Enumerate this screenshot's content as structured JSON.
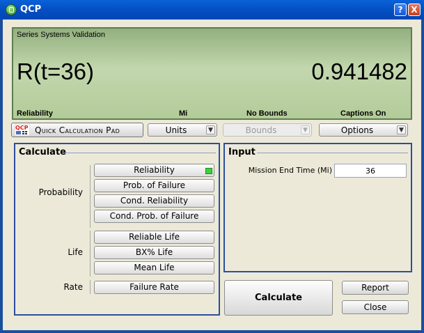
{
  "window": {
    "title": "QCP",
    "help_symbol": "?",
    "close_symbol": "X"
  },
  "display": {
    "title": "Series Systems Validation",
    "result_label": "R(t=36)",
    "result_value": "0.941482",
    "status": {
      "metric": "Reliability",
      "units": "Mi",
      "bounds": "No Bounds",
      "captions": "Captions On"
    }
  },
  "toolbar": {
    "qcp_button_label": "Quick Calculation Pad",
    "units_label": "Units",
    "bounds_label": "Bounds",
    "options_label": "Options"
  },
  "calculate": {
    "title": "Calculate",
    "groups": {
      "probability": "Probability",
      "life": "Life",
      "rate": "Rate"
    },
    "buttons": {
      "reliability": "Reliability",
      "prob_failure": "Prob. of Failure",
      "cond_reliability": "Cond. Reliability",
      "cond_prob_failure": "Cond. Prob. of Failure",
      "reliable_life": "Reliable Life",
      "bx_life": "BX% Life",
      "mean_life": "Mean Life",
      "failure_rate": "Failure Rate"
    },
    "selected": "Reliability"
  },
  "input": {
    "title": "Input",
    "mission_end_time_label": "Mission End Time (Mi)",
    "mission_end_time_value": "36"
  },
  "actions": {
    "calculate": "Calculate",
    "report": "Report",
    "close": "Close"
  },
  "colors": {
    "titlebar": "#0450c4",
    "display_bg": "#b3cb99",
    "panel_border": "#2c4e9e",
    "active_marker": "#3fcf3f"
  }
}
